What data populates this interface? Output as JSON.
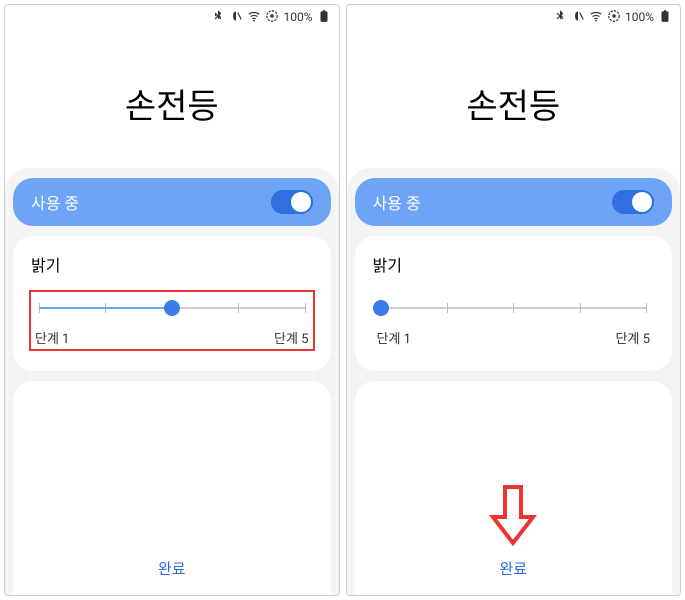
{
  "statusbar": {
    "battery_pct": "100%"
  },
  "left": {
    "title": "손전등",
    "toggle_label": "사용 중",
    "toggle_on": true,
    "brightness": {
      "label": "밝기",
      "min_label": "단계 1",
      "max_label": "단계 5",
      "steps": 5,
      "value": 3,
      "highlighted": true
    },
    "done_label": "완료"
  },
  "right": {
    "title": "손전등",
    "toggle_label": "사용 중",
    "toggle_on": true,
    "brightness": {
      "label": "밝기",
      "min_label": "단계 1",
      "max_label": "단계 5",
      "steps": 5,
      "value": 1,
      "highlighted": false
    },
    "done_label": "완료",
    "arrow_hint": true
  }
}
